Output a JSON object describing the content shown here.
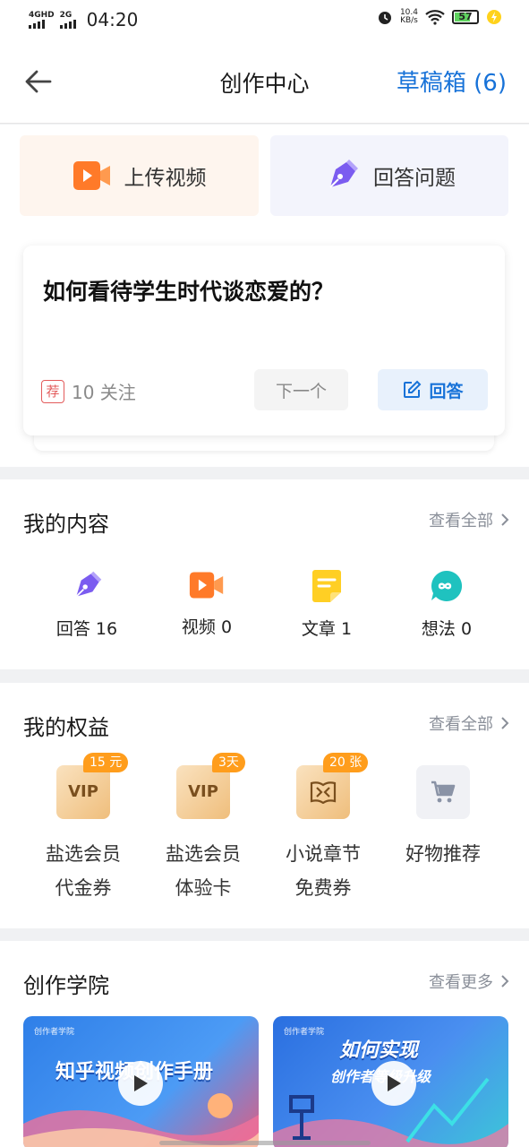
{
  "status": {
    "network1": "4GHD",
    "network2": "2G",
    "time": "04:20",
    "speed_value": "10.4",
    "speed_unit": "KB/s",
    "battery": "57"
  },
  "header": {
    "title": "创作中心",
    "drafts": "草稿箱 (6)"
  },
  "actions": {
    "upload": "上传视频",
    "answer": "回答问题"
  },
  "question": {
    "title": "如何看待学生时代谈恋爱的？",
    "tag": "荐",
    "follow": "10 关注",
    "next": "下一个",
    "answer": "回答"
  },
  "my_content": {
    "title": "我的内容",
    "more": "查看全部",
    "items": [
      {
        "label": "回答 16",
        "icon": "pen-icon"
      },
      {
        "label": "视频 0",
        "icon": "video-icon"
      },
      {
        "label": "文章 1",
        "icon": "article-icon"
      },
      {
        "label": "想法 0",
        "icon": "idea-icon"
      }
    ]
  },
  "benefits": {
    "title": "我的权益",
    "more": "查看全部",
    "items": [
      {
        "line1": "盐选会员",
        "line2": "代金券",
        "badge": "15 元",
        "icon_text": "VIP"
      },
      {
        "line1": "盐选会员",
        "line2": "体验卡",
        "badge": "3天",
        "icon_text": "VIP"
      },
      {
        "line1": "小说章节",
        "line2": "免费券",
        "badge": "20 张",
        "icon_text": ""
      },
      {
        "line1": "好物推荐",
        "line2": "",
        "badge": "",
        "icon_text": ""
      }
    ]
  },
  "academy": {
    "title": "创作学院",
    "more": "查看更多",
    "videos": [
      {
        "title": "知乎视频创作手册",
        "logo": "创作者学院"
      },
      {
        "title_line1": "如何实现",
        "title_line2": "创作者等级升级",
        "logo": "创作者学院"
      }
    ]
  },
  "colors": {
    "accent": "#1772d8",
    "badge": "#ff9d1c",
    "upload_bg": "#fef5ee",
    "answer_bg": "#f3f4fc"
  }
}
